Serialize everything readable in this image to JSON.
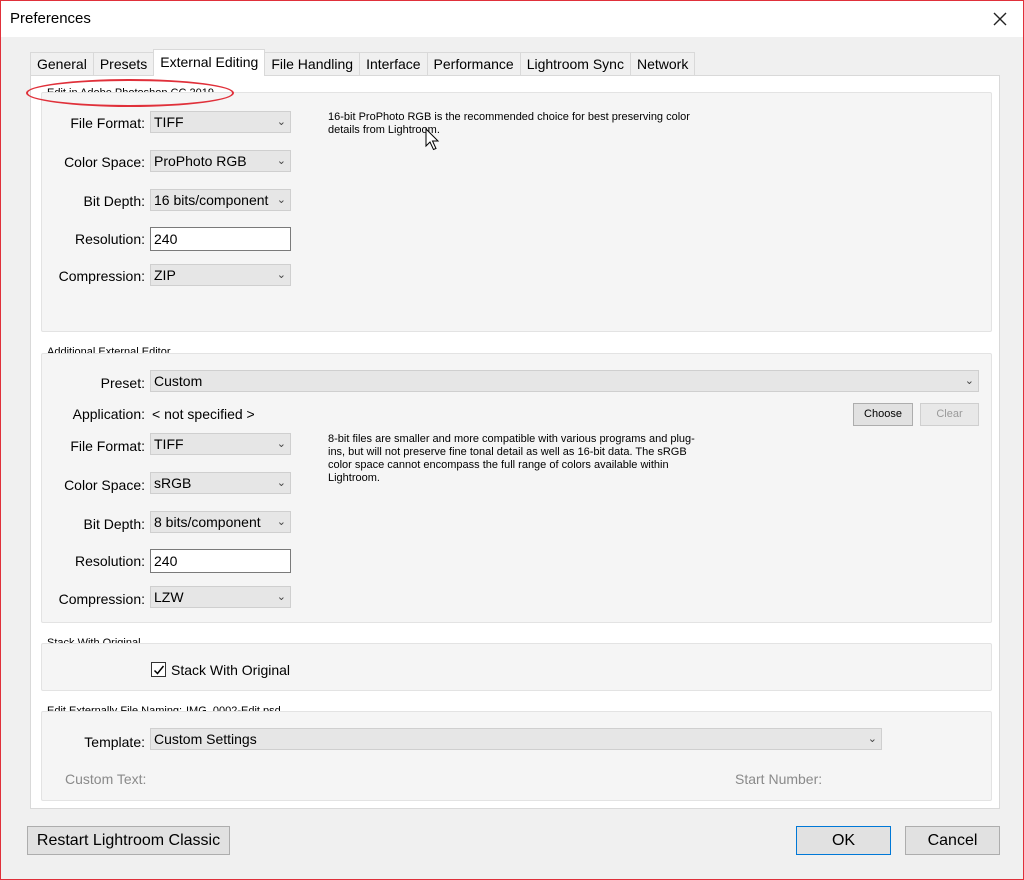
{
  "window": {
    "title": "Preferences"
  },
  "tabs": [
    {
      "label": "General"
    },
    {
      "label": "Presets"
    },
    {
      "label": "External Editing"
    },
    {
      "label": "File Handling"
    },
    {
      "label": "Interface"
    },
    {
      "label": "Performance"
    },
    {
      "label": "Lightroom Sync"
    },
    {
      "label": "Network"
    }
  ],
  "photoshop_section": {
    "title": "Edit in Adobe Photoshop CC 2019",
    "file_format_label": "File Format:",
    "file_format": "TIFF",
    "color_space_label": "Color Space:",
    "color_space": "ProPhoto RGB",
    "bit_depth_label": "Bit Depth:",
    "bit_depth": "16 bits/component",
    "resolution_label": "Resolution:",
    "resolution": "240",
    "compression_label": "Compression:",
    "compression": "ZIP",
    "hint": "16-bit ProPhoto RGB is the recommended choice for best preserving color details from Lightroom."
  },
  "additional_section": {
    "title": "Additional External Editor",
    "preset_label": "Preset:",
    "preset": "Custom",
    "application_label": "Application:",
    "application": "< not specified >",
    "choose_label": "Choose",
    "clear_label": "Clear",
    "file_format_label": "File Format:",
    "file_format": "TIFF",
    "color_space_label": "Color Space:",
    "color_space": "sRGB",
    "bit_depth_label": "Bit Depth:",
    "bit_depth": "8 bits/component",
    "resolution_label": "Resolution:",
    "resolution": "240",
    "compression_label": "Compression:",
    "compression": "LZW",
    "hint": "8-bit files are smaller and more compatible with various programs and plug-ins, but will not preserve fine tonal detail as well as 16-bit data. The sRGB color space cannot encompass the full range of colors available within Lightroom."
  },
  "stack_section": {
    "title": "Stack With Original",
    "checkbox_label": "Stack With Original",
    "checked": true
  },
  "naming_section": {
    "title": "Edit Externally File Naming:",
    "example": "IMG_0002-Edit.psd",
    "template_label": "Template:",
    "template": "Custom Settings",
    "custom_text_label": "Custom Text:",
    "start_number_label": "Start Number:"
  },
  "footer": {
    "restart_label": "Restart Lightroom Classic",
    "ok_label": "OK",
    "cancel_label": "Cancel"
  },
  "icons": {
    "close": "close-icon",
    "chevron": "chevron-down-icon",
    "check": "check-icon",
    "cursor": "mouse-pointer-icon"
  },
  "colors": {
    "annotation": "#e0303a",
    "accent": "#0078d7"
  }
}
